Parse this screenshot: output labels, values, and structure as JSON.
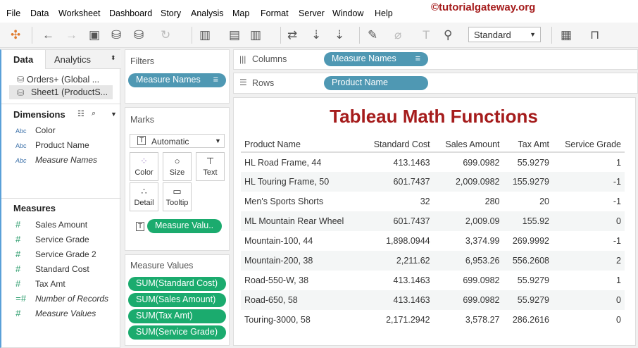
{
  "menu": [
    "File",
    "Data",
    "Worksheet",
    "Dashboard",
    "Story",
    "Analysis",
    "Map",
    "Format",
    "Server",
    "Window",
    "Help"
  ],
  "watermark": "©tutorialgateway.org",
  "toolbar": {
    "fit_select": "Standard"
  },
  "data_pane": {
    "tabs": [
      "Data",
      "Analytics"
    ],
    "sources": [
      "Orders+ (Global ...",
      "Sheet1 (ProductS..."
    ],
    "dimensions_title": "Dimensions",
    "dimensions": [
      {
        "type": "Abc",
        "label": "Color"
      },
      {
        "type": "Abc",
        "label": "Product Name"
      },
      {
        "type": "Abc",
        "label": "Measure Names"
      }
    ],
    "measures_title": "Measures",
    "measures": [
      "Sales Amount",
      "Service Grade",
      "Service Grade 2",
      "Standard Cost",
      "Tax Amt",
      "Number of Records",
      "Measure Values"
    ]
  },
  "filters": {
    "title": "Filters",
    "pill": "Measure Names"
  },
  "marks": {
    "title": "Marks",
    "type": "Automatic",
    "cards": [
      "Color",
      "Size",
      "Text",
      "Detail",
      "Tooltip"
    ],
    "pill": "Measure Valu.."
  },
  "measure_values": {
    "title": "Measure Values",
    "pills": [
      "SUM(Standard Cost)",
      "SUM(Sales Amount)",
      "SUM(Tax Amt)",
      "SUM(Service Grade)"
    ]
  },
  "shelves": {
    "columns_label": "Columns",
    "columns_pill": "Measure Names",
    "rows_label": "Rows",
    "rows_pill": "Product Name"
  },
  "viz": {
    "title": "Tableau Math Functions",
    "title_color": "#a51c1c",
    "headers": [
      "Product Name",
      "Standard Cost",
      "Sales Amount",
      "Tax Amt",
      "Service Grade"
    ],
    "rows": [
      [
        "HL Road Frame, 44",
        "413.1463",
        "699.0982",
        "55.9279",
        "1"
      ],
      [
        "HL Touring Frame, 50",
        "601.7437",
        "2,009.0982",
        "155.9279",
        "-1"
      ],
      [
        "Men's Sports Shorts",
        "32",
        "280",
        "20",
        "-1"
      ],
      [
        "ML Mountain Rear Wheel",
        "601.7437",
        "2,009.09",
        "155.92",
        "0"
      ],
      [
        "Mountain-100, 44",
        "1,898.0944",
        "3,374.99",
        "269.9992",
        "-1"
      ],
      [
        "Mountain-200, 38",
        "2,211.62",
        "6,953.26",
        "556.2608",
        "2"
      ],
      [
        "Road-550-W, 38",
        "413.1463",
        "699.0982",
        "55.9279",
        "1"
      ],
      [
        "Road-650, 58",
        "413.1463",
        "699.0982",
        "55.9279",
        "0"
      ],
      [
        "Touring-3000, 58",
        "2,171.2942",
        "3,578.27",
        "286.2616",
        "0"
      ]
    ]
  }
}
